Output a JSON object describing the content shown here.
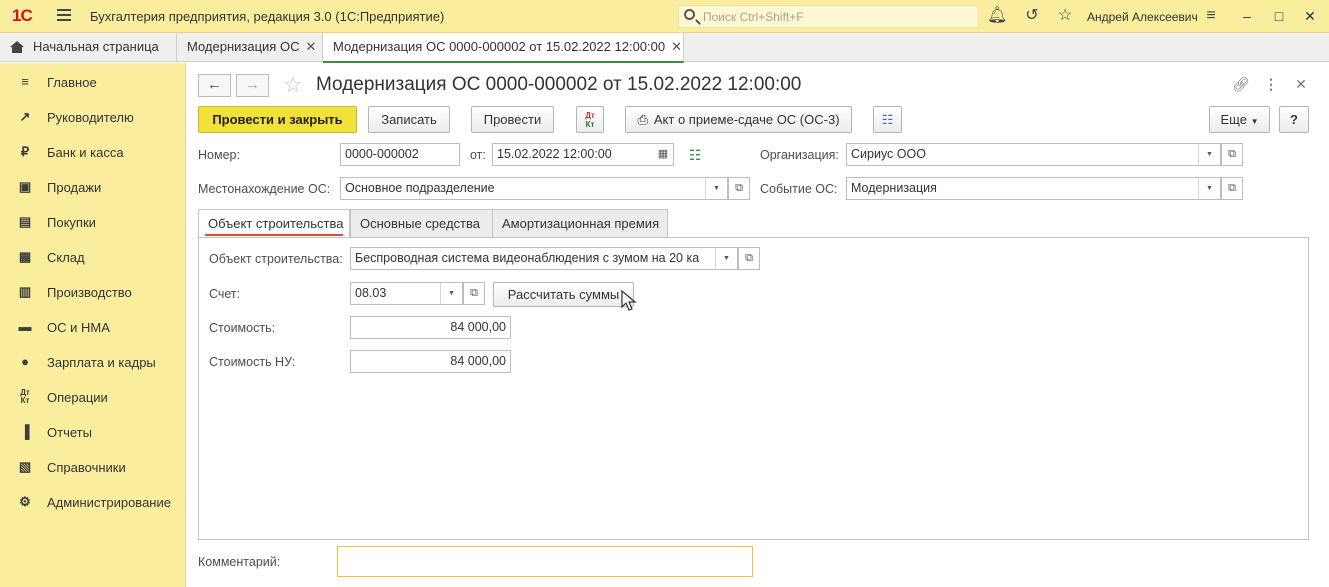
{
  "titlebar": {
    "logo": "1С",
    "app_title": "Бухгалтерия предприятия, редакция 3.0  (1С:Предприятие)",
    "search_placeholder": "Поиск Ctrl+Shift+F",
    "user": "Андрей Алексеевич"
  },
  "tabs": [
    {
      "label": "Начальная страница"
    },
    {
      "label": "Модернизация ОС",
      "close": "✕"
    },
    {
      "label": "Модернизация ОС 0000-000002 от 15.02.2022 12:00:00",
      "close": "✕"
    }
  ],
  "sidebar": {
    "items": [
      {
        "label": "Главное",
        "icon": "menu-icon"
      },
      {
        "label": "Руководителю",
        "icon": "trend-icon"
      },
      {
        "label": "Банк и касса",
        "icon": "ruble-coin-icon"
      },
      {
        "label": "Продажи",
        "icon": "shopping-bag-icon"
      },
      {
        "label": "Покупки",
        "icon": "cart-icon"
      },
      {
        "label": "Склад",
        "icon": "warehouse-icon"
      },
      {
        "label": "Производство",
        "icon": "factory-icon"
      },
      {
        "label": "ОС и НМА",
        "icon": "truck-icon"
      },
      {
        "label": "Зарплата и кадры",
        "icon": "person-icon"
      },
      {
        "label": "Операции",
        "icon": "dt-kt-icon"
      },
      {
        "label": "Отчеты",
        "icon": "bar-chart-icon"
      },
      {
        "label": "Справочники",
        "icon": "book-icon"
      },
      {
        "label": "Администрирование",
        "icon": "gear-icon"
      }
    ]
  },
  "document": {
    "title": "Модернизация ОС 0000-000002 от 15.02.2022 12:00:00"
  },
  "toolbar": {
    "post_close": "Провести и закрыть",
    "save": "Записать",
    "post": "Провести",
    "dtkt_top": "Дт",
    "dtkt_bottom": "Кт",
    "act": "Акт о приеме-сдаче ОС (ОС-3)",
    "more": "Еще",
    "help": "?"
  },
  "header_fields": {
    "number_label": "Номер:",
    "number_value": "0000-000002",
    "date_label": "от:",
    "date_value": "15.02.2022 12:00:00",
    "org_label": "Организация:",
    "org_value": "Сириус ООО",
    "location_label": "Местонахождение ОС:",
    "location_value": "Основное подразделение",
    "event_label": "Событие ОС:",
    "event_value": "Модернизация"
  },
  "form_tabs": [
    {
      "label": "Объект строительства"
    },
    {
      "label": "Основные средства"
    },
    {
      "label": "Амортизационная премия"
    }
  ],
  "construction": {
    "object_label": "Объект строительства:",
    "object_value": "Беспроводная система видеонаблюдения с зумом на 20 ка",
    "account_label": "Счет:",
    "account_value": "08.03",
    "calc_button": "Рассчитать суммы",
    "cost_label": "Стоимость:",
    "cost_value": "84 000,00",
    "cost_tax_label": "Стоимость НУ:",
    "cost_tax_value": "84 000,00"
  },
  "comment": {
    "label": "Комментарий:",
    "value": ""
  }
}
